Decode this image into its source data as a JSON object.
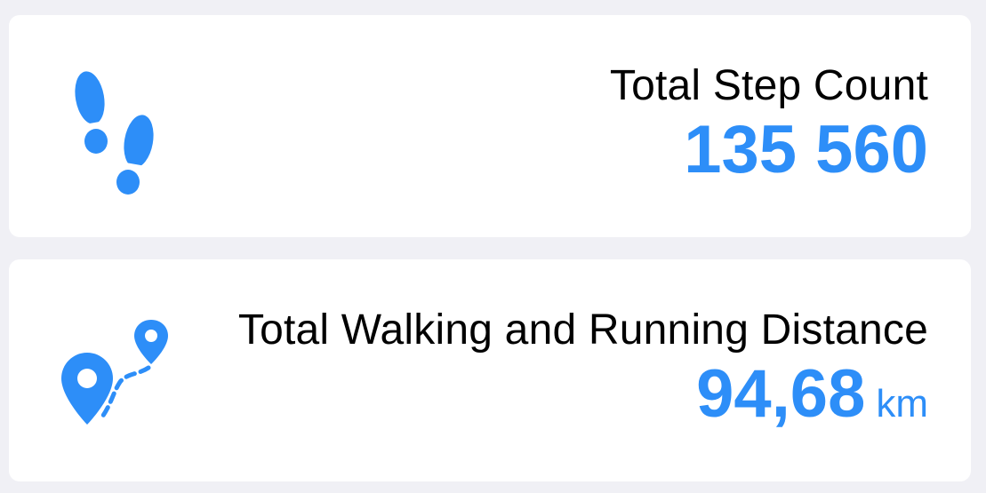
{
  "accent_color": "#2d8ef8",
  "background_color": "#f0f0f5",
  "cards": [
    {
      "icon": "footsteps-icon",
      "title": "Total Step Count",
      "value": "135 560"
    },
    {
      "icon": "route-pin-icon",
      "title": "Total Walking and Running Distance",
      "value": "94,68",
      "unit": "km"
    }
  ]
}
